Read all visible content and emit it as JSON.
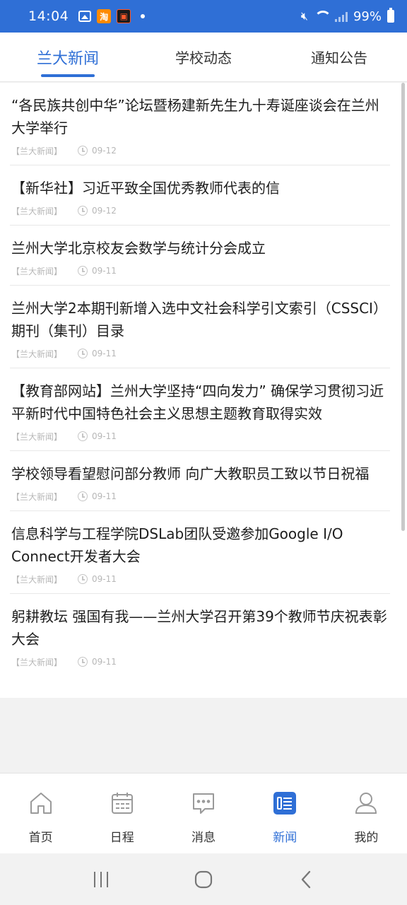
{
  "status_bar": {
    "time": "14:04",
    "battery": "99%"
  },
  "tabs": [
    {
      "label": "兰大新闻",
      "active": true
    },
    {
      "label": "学校动态",
      "active": false
    },
    {
      "label": "通知公告",
      "active": false
    }
  ],
  "news": [
    {
      "title": "“各民族共创中华”论坛暨杨建新先生九十寿诞座谈会在兰州大学举行",
      "source": "【兰大新闻】",
      "date": "09-12"
    },
    {
      "title": "【新华社】习近平致全国优秀教师代表的信",
      "source": "【兰大新闻】",
      "date": "09-12"
    },
    {
      "title": "兰州大学北京校友会数学与统计分会成立",
      "source": "【兰大新闻】",
      "date": "09-11"
    },
    {
      "title": "兰州大学2本期刊新增入选中文社会科学引文索引（CSSCI）期刊（集刊）目录",
      "source": "【兰大新闻】",
      "date": "09-11"
    },
    {
      "title": "【教育部网站】兰州大学坚持“四向发力” 确保学习贯彻习近平新时代中国特色社会主义思想主题教育取得实效",
      "source": "【兰大新闻】",
      "date": "09-11"
    },
    {
      "title": "学校领导看望慰问部分教师 向广大教职员工致以节日祝福",
      "source": "【兰大新闻】",
      "date": "09-11"
    },
    {
      "title": "信息科学与工程学院DSLab团队受邀参加Google I/O Connect开发者大会",
      "source": "【兰大新闻】",
      "date": "09-11"
    },
    {
      "title": "躬耕教坛 强国有我——兰州大学召开第39个教师节庆祝表彰大会",
      "source": "【兰大新闻】",
      "date": "09-11"
    }
  ],
  "bottom_nav": [
    {
      "label": "首页",
      "icon": "home-icon",
      "active": false
    },
    {
      "label": "日程",
      "icon": "calendar-icon",
      "active": false
    },
    {
      "label": "消息",
      "icon": "message-icon",
      "active": false
    },
    {
      "label": "新闻",
      "icon": "news-icon",
      "active": true
    },
    {
      "label": "我的",
      "icon": "profile-icon",
      "active": false
    }
  ],
  "colors": {
    "accent": "#2f6fd6",
    "meta": "#b7b7b7"
  }
}
